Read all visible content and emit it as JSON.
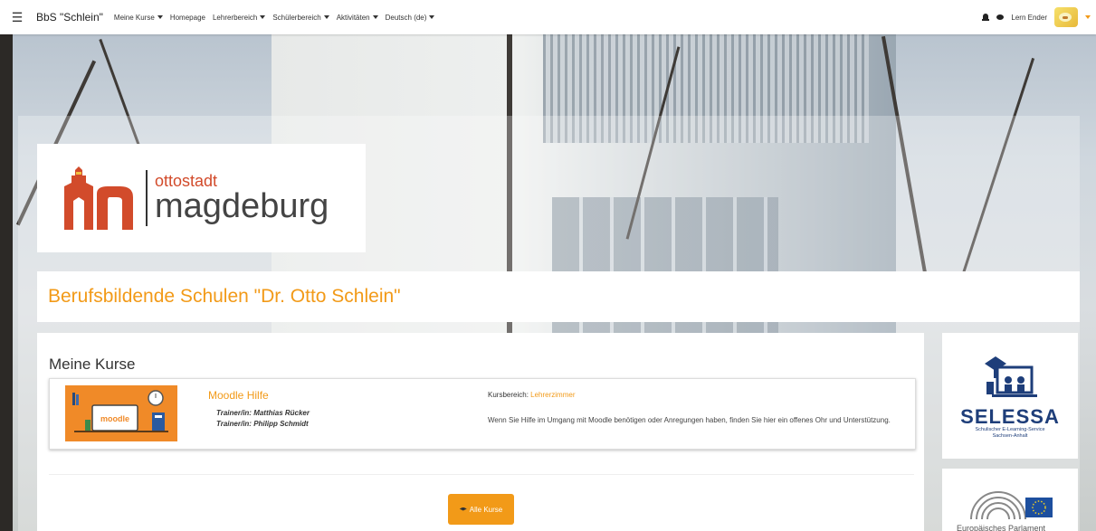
{
  "navbar": {
    "menu_icon": "hamburger-icon",
    "brand": "BbS \"Schlein\"",
    "items": [
      {
        "label": "Meine Kurse",
        "dropdown": true
      },
      {
        "label": "Homepage",
        "dropdown": false
      },
      {
        "label": "Lehrerbereich",
        "dropdown": true
      },
      {
        "label": "Schülerbereich",
        "dropdown": true
      },
      {
        "label": "Aktivitäten",
        "dropdown": true
      },
      {
        "label": "Deutsch (de)",
        "dropdown": true
      }
    ],
    "notifications_icon": "bell-icon",
    "messages_icon": "chat-icon",
    "user_name": "Lern Ender"
  },
  "logo": {
    "line1": "ottostadt",
    "line2": "magdeburg"
  },
  "page_title": "Berufsbildende Schulen \"Dr. Otto Schlein\"",
  "my_courses": {
    "heading": "Meine Kurse",
    "course": {
      "name": "Moodle Hilfe",
      "image_label": "moodle",
      "trainers": [
        "Trainer/in: Matthias Rücker",
        "Trainer/in: Philipp Schmidt"
      ],
      "category_label": "Kursbereich:",
      "category": "Lehrerzimmer",
      "summary": "Wenn Sie Hilfe im Umgang mit Moodle benötigen oder Anregungen haben, finden Sie hier ein offenes Ohr und Unterstützung."
    },
    "all_courses_button": "Alle Kurse"
  },
  "side_blocks": {
    "selessa": {
      "title": "SELESSA",
      "subtitle_line1": "Schulischer E-Learning-Service",
      "subtitle_line2": "Sachsen-Anhalt"
    },
    "parliament": {
      "text": "Europäisches Parlament"
    }
  },
  "colors": {
    "accent": "#f29a18",
    "selessa_blue": "#1e3e7a",
    "logo_red": "#d24b2b"
  }
}
